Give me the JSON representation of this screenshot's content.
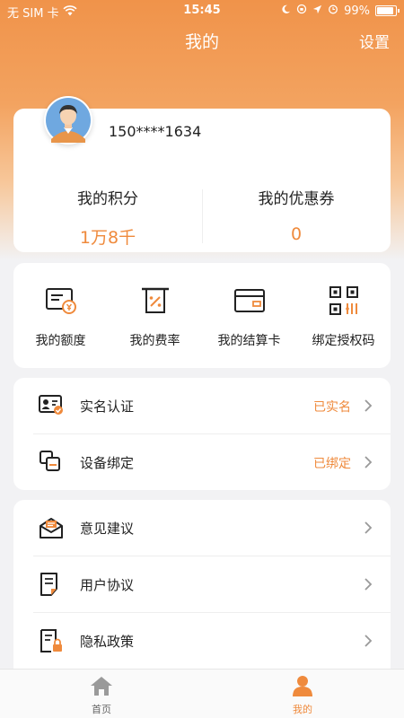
{
  "status_bar": {
    "carrier": "无 SIM 卡",
    "time": "15:45",
    "battery": "99%",
    "battery_level": 0.99
  },
  "nav": {
    "title": "我的",
    "settings_label": "设置"
  },
  "profile": {
    "phone": "150****1634",
    "points_label": "我的积分",
    "points_value": "1万8千",
    "coupons_label": "我的优惠券",
    "coupons_value": "0"
  },
  "grid": [
    {
      "label": "我的额度",
      "icon": "credit-limit-icon"
    },
    {
      "label": "我的费率",
      "icon": "rate-icon"
    },
    {
      "label": "我的结算卡",
      "icon": "bank-card-icon"
    },
    {
      "label": "绑定授权码",
      "icon": "qr-code-icon"
    }
  ],
  "account_list": [
    {
      "label": "实名认证",
      "status": "已实名",
      "icon": "id-card-icon"
    },
    {
      "label": "设备绑定",
      "status": "已绑定",
      "icon": "device-icon"
    }
  ],
  "info_list": [
    {
      "label": "意见建议",
      "icon": "feedback-icon"
    },
    {
      "label": "用户协议",
      "icon": "agreement-icon"
    },
    {
      "label": "隐私政策",
      "icon": "privacy-icon"
    }
  ],
  "tabbar": {
    "home_label": "首页",
    "mine_label": "我的",
    "active_color": "#ef8a3c",
    "inactive_color": "#9a9a9a"
  },
  "colors": {
    "accent": "#ef8a3c",
    "header": "#f0934a"
  }
}
